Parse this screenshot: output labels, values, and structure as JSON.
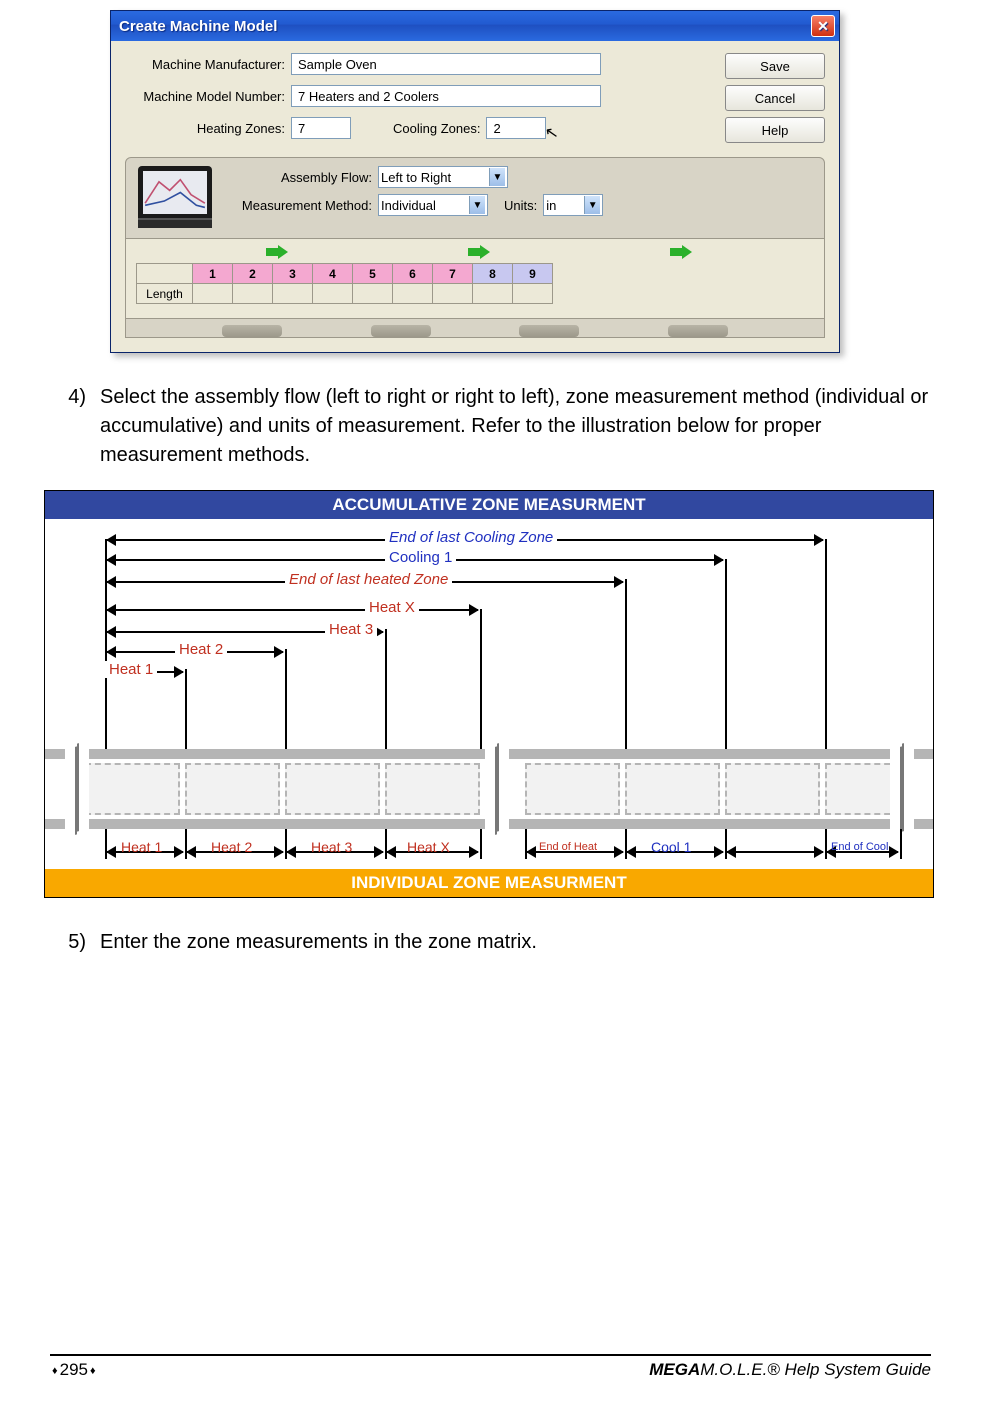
{
  "dialog": {
    "title": "Create Machine Model",
    "manufacturer_label": "Machine Manufacturer:",
    "manufacturer_value": "Sample Oven",
    "model_label": "Machine Model Number:",
    "model_value": "7 Heaters and 2 Coolers",
    "heating_label": "Heating Zones:",
    "heating_value": "7",
    "cooling_label": "Cooling Zones:",
    "cooling_value": "2",
    "save": "Save",
    "cancel": "Cancel",
    "help": "Help",
    "assembly_flow_label": "Assembly Flow:",
    "assembly_flow_value": "Left to Right",
    "measurement_method_label": "Measurement Method:",
    "measurement_method_value": "Individual",
    "units_label": "Units:",
    "units_value": "in",
    "length_label": "Length",
    "zones": [
      "1",
      "2",
      "3",
      "4",
      "5",
      "6",
      "7",
      "8",
      "9"
    ]
  },
  "steps": {
    "s4_num": "4)",
    "s4_text": "Select the assembly flow (left to right or right to left), zone measurement method (individual or accumulative) and units of measurement. Refer to the illustration below for proper measurement methods.",
    "s5_num": "5)",
    "s5_text": "Enter the zone measurements in the zone matrix."
  },
  "diagram": {
    "top_header": "ACCUMULATIVE ZONE MEASURMENT",
    "bottom_header": "INDIVIDUAL ZONE MEASURMENT",
    "acc": {
      "end_cool": "End of last Cooling Zone",
      "cool1": "Cooling 1",
      "end_heat": "End of last heated Zone",
      "heatx": "Heat X",
      "heat3": "Heat 3",
      "heat2": "Heat 2",
      "heat1": "Heat 1"
    },
    "ind": {
      "heat1": "Heat 1",
      "heat2": "Heat 2",
      "heat3": "Heat 3",
      "heatx": "Heat X",
      "end_heat": "End of Heat",
      "cool1": "Cool 1",
      "end_cool": "End of Cool"
    }
  },
  "footer": {
    "page_num": "295",
    "guide_bold": "MEGA",
    "guide_rest": "M.O.L.E.® Help System Guide"
  }
}
